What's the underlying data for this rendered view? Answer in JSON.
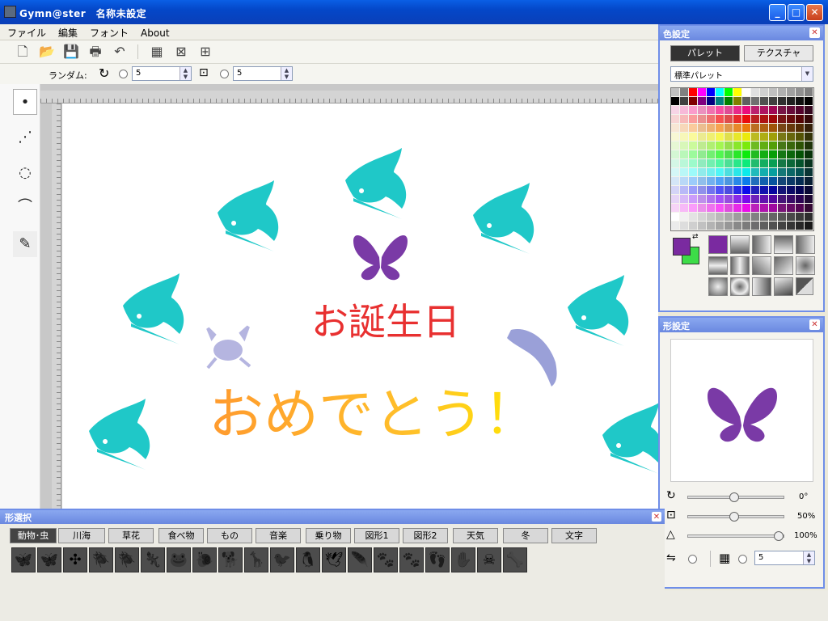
{
  "window": {
    "title": "Gymn@ster　名称未設定"
  },
  "menu": [
    "ファイル",
    "編集",
    "フォント",
    "About"
  ],
  "optbar": {
    "random_label": "ランダム:",
    "rotate_value": "5",
    "size_value": "5"
  },
  "canvas": {
    "title_text": "お誕生日",
    "greeting_text": "おめでとう！"
  },
  "color_panel": {
    "title": "色設定",
    "tabs": [
      "パレット",
      "テクスチャ"
    ],
    "palette_select": "標準パレット",
    "primary_color": "#7a2aa0",
    "secondary_color": "#3ddc48"
  },
  "shape_panel": {
    "title": "形設定",
    "rotation": "0°",
    "scale": "50%",
    "opacity": "100%",
    "count_value": "5"
  },
  "select_panel": {
    "title": "形選択",
    "categories": [
      "動物･虫",
      "川海",
      "草花",
      "食べ物",
      "もの",
      "音楽",
      "乗り物",
      "図形1",
      "図形2",
      "天気",
      "冬",
      "文字"
    ]
  }
}
